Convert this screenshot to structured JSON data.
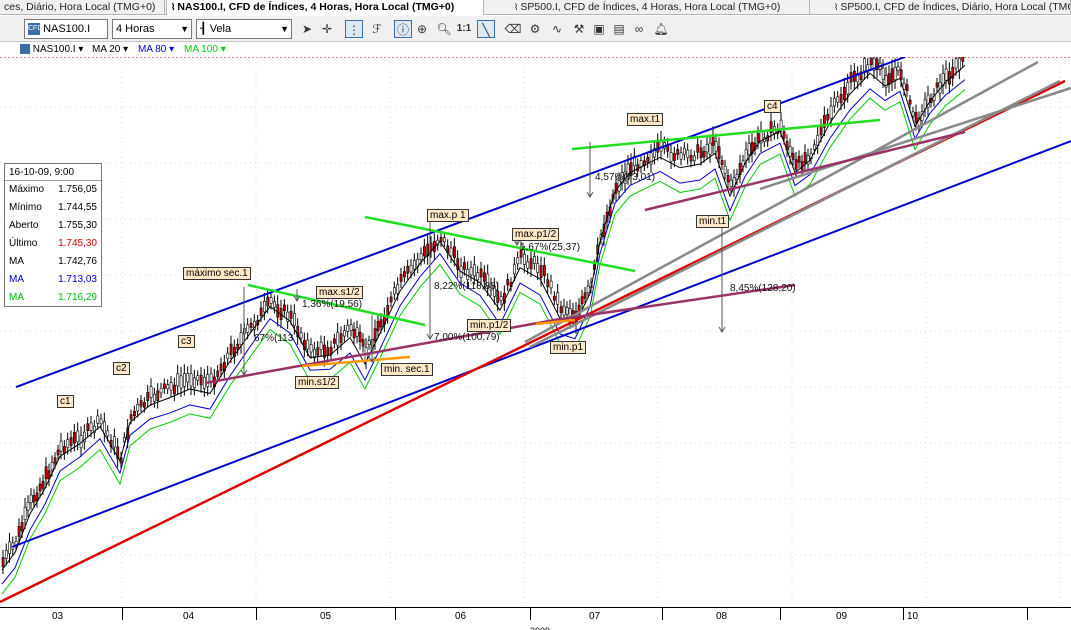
{
  "tabs": [
    {
      "label": "ces, Diário, Hora Local (TMG+0)",
      "active": false
    },
    {
      "label": "NAS100.I, CFD de Índices, 4 Horas, Hora Local (TMG+0)",
      "active": true
    },
    {
      "label": "SP500.I, CFD de Índices, 4 Horas, Hora Local (TMG+0)",
      "active": false
    },
    {
      "label": "SP500.I, CFD de Índices, Diário, Hora Local (TMG+0)",
      "active": false
    }
  ],
  "toolbar": {
    "symbol": "NAS100.I",
    "timeframe": "4 Horas",
    "chart_type": "Vela",
    "tools": [
      "cursor-icon",
      "crosshair-icon",
      "grid-icon",
      "fibonacci-icon",
      "info-icon",
      "zoom-window-icon",
      "zoom-icon",
      "one-to-one-icon",
      "trendline-icon",
      "eraser-icon",
      "chart-settings-icon",
      "indicator-icon",
      "template-icon",
      "layout-icon",
      "link-icon",
      "alarm-icon"
    ],
    "one_to_one": "1:1"
  },
  "indicators": {
    "symbol": "NAS100.I",
    "ma20": "MA 20",
    "ma80": "MA 80",
    "ma100": "MA 100",
    "colors": {
      "ma20": "#000000",
      "ma80": "#0000cc",
      "ma100": "#00cc00"
    }
  },
  "infobox": {
    "date": "16-10-09, 9:00",
    "rows": [
      {
        "label": "Máximo",
        "value": "1.756,05",
        "color": "#000000"
      },
      {
        "label": "Mínimo",
        "value": "1.744,55",
        "color": "#000000"
      },
      {
        "label": "Aberto",
        "value": "1.755,30",
        "color": "#000000"
      },
      {
        "label": "Último",
        "value": "1.745,30",
        "color": "#cc0000"
      },
      {
        "label": "MA",
        "value": "1.742,76",
        "color": "#000000"
      },
      {
        "label": "MA",
        "value": "1.713,03",
        "color": "#0000cc"
      },
      {
        "label": "MA",
        "value": "1.716,29",
        "color": "#00cc00"
      }
    ]
  },
  "chart_data": {
    "type": "candlestick",
    "x_months": [
      "03",
      "04",
      "05",
      "06",
      "07",
      "08",
      "09",
      "10"
    ],
    "year": "2009",
    "labels": [
      {
        "text": "c1"
      },
      {
        "text": "c2"
      },
      {
        "text": "c3"
      },
      {
        "text": "c4"
      },
      {
        "text": "máximo sec.1"
      },
      {
        "text": "max.s1/2"
      },
      {
        "text": "min.s1/2"
      },
      {
        "text": "min. sec.1"
      },
      {
        "text": "max.p 1"
      },
      {
        "text": "max.p1/2"
      },
      {
        "text": "min.p1/2"
      },
      {
        "text": "min.p1"
      },
      {
        "text": "max.t1"
      },
      {
        "text": "min.t1"
      }
    ],
    "annotations": [
      "1,36%(19,56)",
      "8,22%(118,88)",
      "7,00%(100,79)",
      "1,67%(25,37)",
      "4,57%(73,01)",
      "8,45%(128,20)",
      "67%(113"
    ],
    "colors": {
      "up": "#ffffff",
      "down": "#cc0000",
      "ma20": "#000000",
      "ma80": "#0000cc",
      "ma100": "#00cc00",
      "channel": "#0000cc",
      "support": "#dd0000"
    }
  }
}
